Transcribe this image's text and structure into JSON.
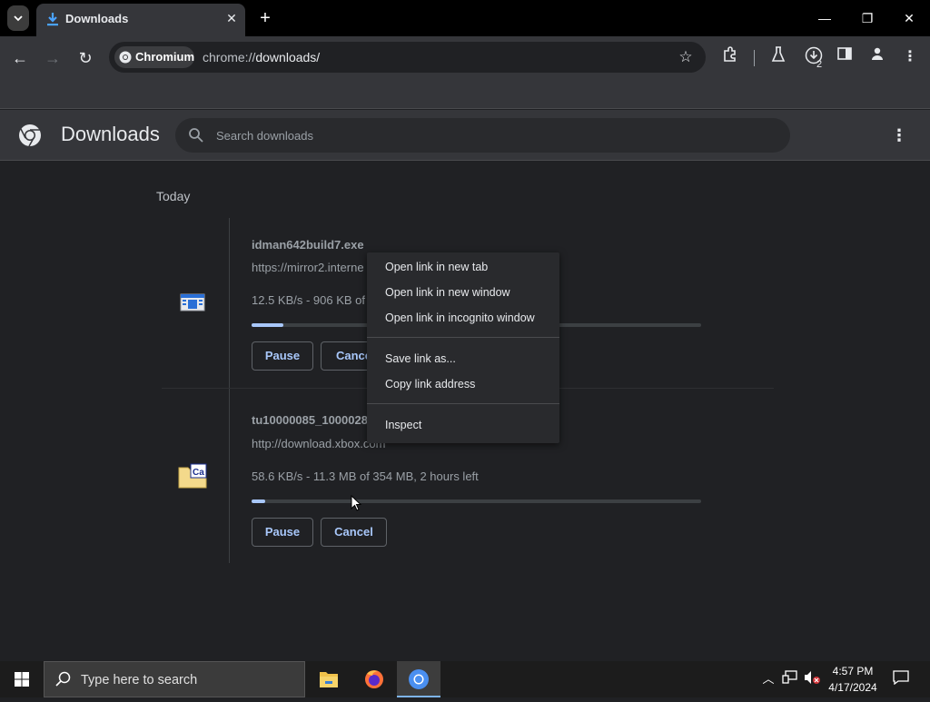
{
  "browser": {
    "tab_title": "Downloads",
    "chip_label": "Chromium",
    "url_scheme": "chrome://",
    "url_path": "downloads/",
    "download_badge": "2"
  },
  "page": {
    "title": "Downloads",
    "search_placeholder": "Search downloads",
    "section": "Today"
  },
  "downloads": [
    {
      "filename": "idman642build7.exe",
      "url": "https://mirror2.interne",
      "status": "12.5 KB/s - 906 KB of",
      "progress": 0.07,
      "pause_label": "Pause",
      "cancel_label": "Cance"
    },
    {
      "filename": "tu10000085_10000285",
      "url": "http://download.xbox.com",
      "status": "58.6 KB/s - 11.3 MB of 354 MB, 2 hours left",
      "progress": 0.03,
      "pause_label": "Pause",
      "cancel_label": "Cancel"
    }
  ],
  "context_menu": {
    "items": [
      "Open link in new tab",
      "Open link in new window",
      "Open link in incognito window",
      "Save link as...",
      "Copy link address",
      "Inspect"
    ]
  },
  "taskbar": {
    "search_placeholder": "Type here to search",
    "time": "4:57 PM",
    "date": "4/17/2024"
  },
  "colors": {
    "accent": "#a8c7fa",
    "page_bg": "#202124",
    "header_bg": "#35363a"
  }
}
